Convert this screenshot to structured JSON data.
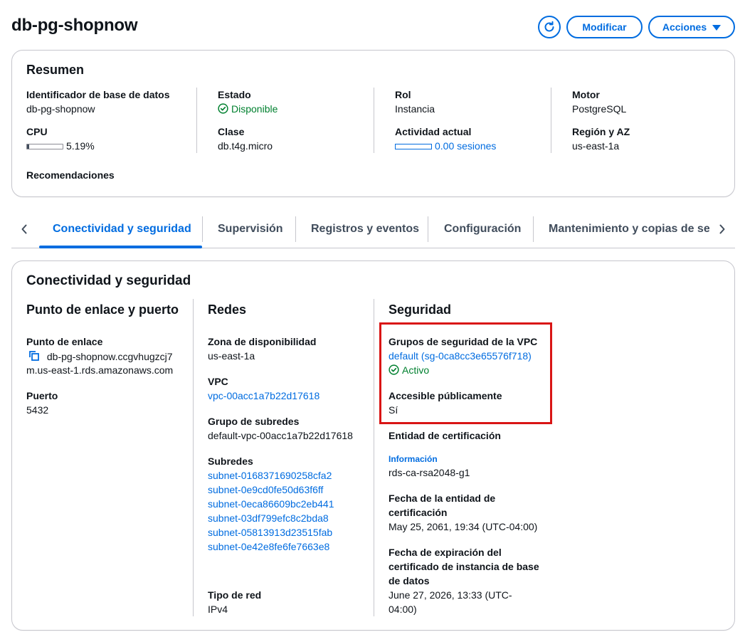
{
  "header": {
    "title": "db-pg-shopnow",
    "modify_label": "Modificar",
    "actions_label": "Acciones"
  },
  "summary": {
    "heading": "Resumen",
    "db_id_label": "Identificador de base de datos",
    "db_id_value": "db-pg-shopnow",
    "cpu_label": "CPU",
    "cpu_value": "5.19%",
    "cpu_fraction": 0.0519,
    "recommendations_label": "Recomendaciones",
    "state_label": "Estado",
    "state_value": "Disponible",
    "class_label": "Clase",
    "class_value": "db.t4g.micro",
    "role_label": "Rol",
    "role_value": "Instancia",
    "activity_label": "Actividad actual",
    "activity_value": "0.00 sesiones",
    "engine_label": "Motor",
    "engine_value": "PostgreSQL",
    "region_label": "Región y AZ",
    "region_value": "us-east-1a"
  },
  "tabs": [
    {
      "label": "Conectividad y seguridad",
      "active": true
    },
    {
      "label": "Supervisión",
      "active": false
    },
    {
      "label": "Registros y eventos",
      "active": false
    },
    {
      "label": "Configuración",
      "active": false
    },
    {
      "label": "Mantenimiento y copias de seg",
      "active": false
    }
  ],
  "connectivity": {
    "heading": "Conectividad y seguridad",
    "endpoint_section": {
      "heading": "Punto de enlace y puerto",
      "endpoint_label": "Punto de enlace",
      "endpoint_line1": "db-pg-shopnow.ccgvhugzcj7",
      "endpoint_line2": "m.us-east-1.rds.amazonaws.com",
      "port_label": "Puerto",
      "port_value": "5432"
    },
    "network_section": {
      "heading": "Redes",
      "az_label": "Zona de disponibilidad",
      "az_value": "us-east-1a",
      "vpc_label": "VPC",
      "vpc_value": "vpc-00acc1a7b22d17618",
      "subnet_group_label": "Grupo de subredes",
      "subnet_group_value": "default-vpc-00acc1a7b22d17618",
      "subnets_label": "Subredes",
      "subnets": [
        "subnet-0168371690258cfa2",
        "subnet-0e9cd0fe50d63f6ff",
        "subnet-0eca86609bc2eb441",
        "subnet-03df799efc8c2bda8",
        "subnet-05813913d23515fab",
        "subnet-0e42e8fe6fe7663e8"
      ],
      "network_type_label": "Tipo de red",
      "network_type_value": "IPv4"
    },
    "security_section": {
      "heading": "Seguridad",
      "sg_label": "Grupos de seguridad de la VPC",
      "sg_value": "default (sg-0ca8cc3e65576f718)",
      "sg_status": "Activo",
      "public_label": "Accesible públicamente",
      "public_value": "Sí",
      "ca_label": "Entidad de certificación",
      "ca_info": "Información",
      "ca_value": "rds-ca-rsa2048-g1",
      "ca_date_label_1": "Fecha de la entidad de",
      "ca_date_label_2": "certificación",
      "ca_date_value": "May 25, 2061, 19:34 (UTC-04:00)",
      "cert_exp_label_1": "Fecha de expiración del",
      "cert_exp_label_2": "certificado de instancia de base",
      "cert_exp_label_3": "de datos",
      "cert_exp_value_1": "June 27, 2026, 13:33 (UTC-",
      "cert_exp_value_2": "04:00)"
    }
  },
  "colors": {
    "accent": "#006ce0",
    "success": "#00802f",
    "highlight": "#d91515",
    "border": "#c6c6cd"
  }
}
